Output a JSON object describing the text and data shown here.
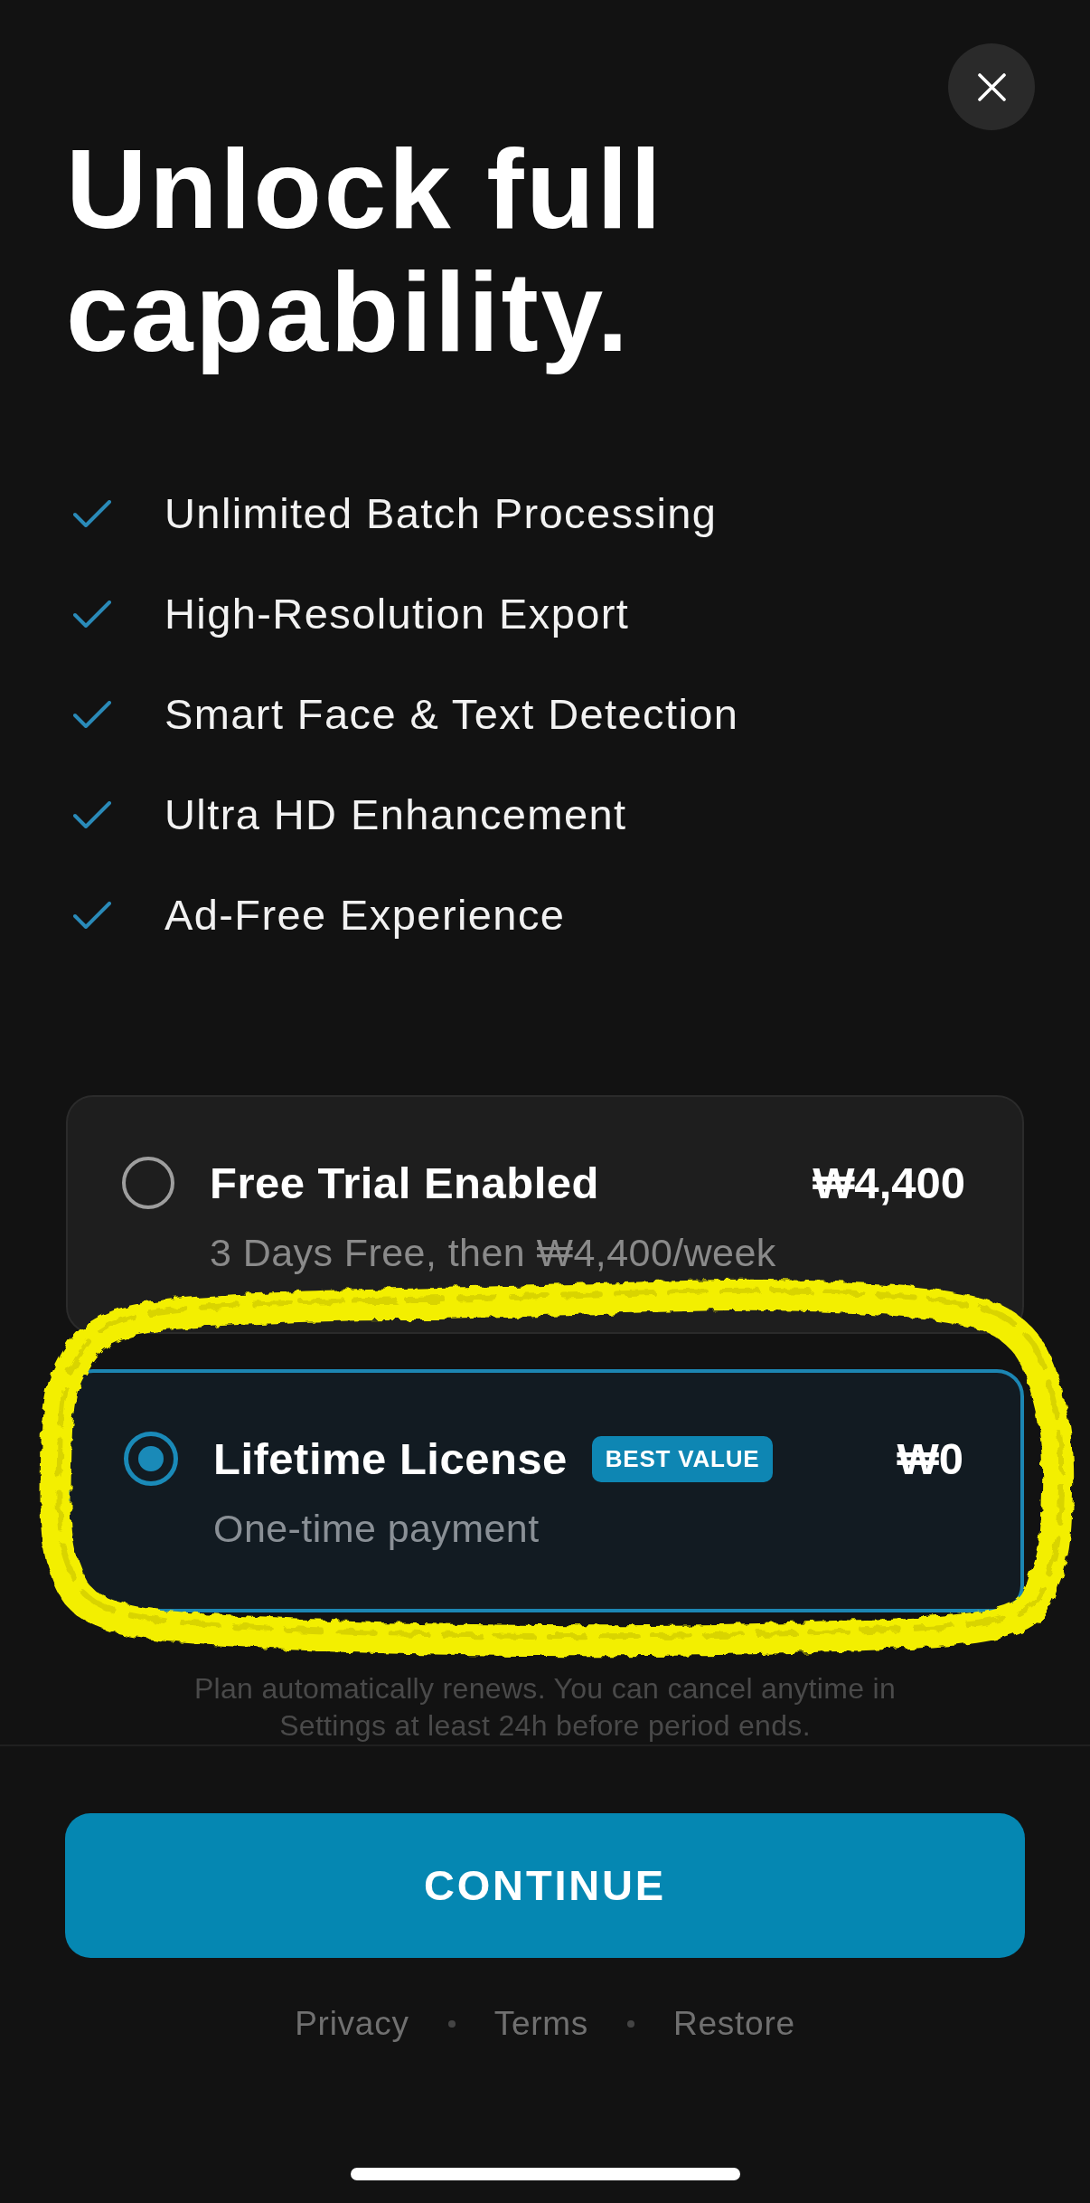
{
  "heading": "Unlock full capability.",
  "features": [
    {
      "label": "Unlimited Batch Processing"
    },
    {
      "label": "High-Resolution Export"
    },
    {
      "label": "Smart Face & Text Detection"
    },
    {
      "label": "Ultra HD Enhancement"
    },
    {
      "label": "Ad-Free Experience"
    }
  ],
  "plans": [
    {
      "title": "Free Trial Enabled",
      "price": "₩4,400",
      "subtitle": "3 Days Free, then ₩4,400/week",
      "selected": false,
      "circled": false
    },
    {
      "title": "Lifetime License",
      "badge": "BEST VALUE",
      "price": "₩0",
      "subtitle": "One-time payment",
      "selected": true,
      "circled": true
    }
  ],
  "disclaimer": "Plan automatically renews. You can cancel anytime in Settings at least 24h before period ends.",
  "continue_button": {
    "label": "CONTINUE"
  },
  "footer_links": [
    "Privacy",
    "Terms",
    "Restore"
  ]
}
